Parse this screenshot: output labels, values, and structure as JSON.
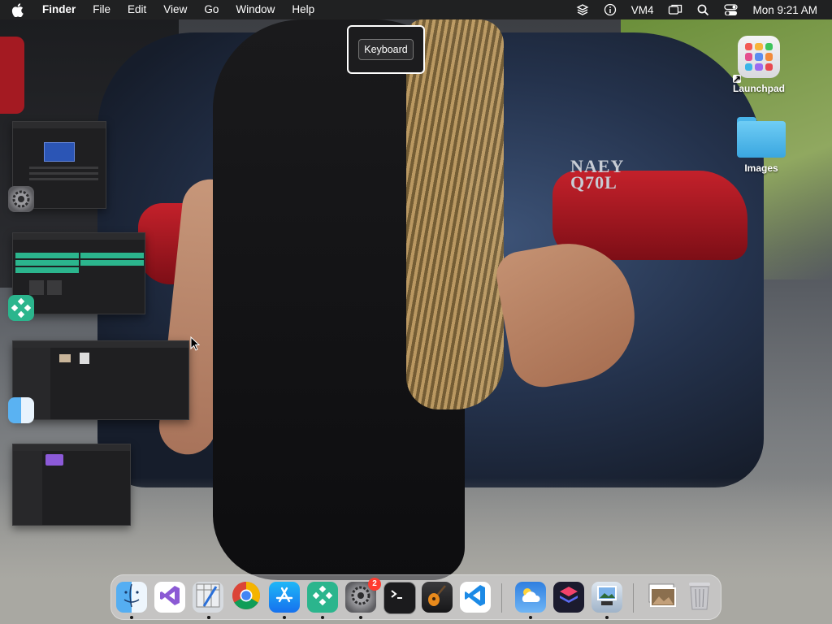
{
  "menubar": {
    "apple_icon": "apple-logo-icon",
    "app_name": "Finder",
    "menus": [
      "File",
      "Edit",
      "View",
      "Go",
      "Window",
      "Help"
    ],
    "status_label": "VM4",
    "clock": "Mon 9:21 AM"
  },
  "hud": {
    "label": "Keyboard"
  },
  "desktop": {
    "icons": [
      {
        "label": "Launchpad",
        "icon": "launchpad-icon"
      },
      {
        "label": "Images",
        "icon": "folder-icon"
      }
    ]
  },
  "wallpaper": {
    "car_badge": "NAEY\nQ70L"
  },
  "stage_manager": {
    "apps": [
      "System Settings",
      "App with green cells",
      "Finder",
      "Notes-like app"
    ]
  },
  "dock": {
    "items": [
      {
        "name": "Finder",
        "icon": "finder-icon",
        "running": true
      },
      {
        "name": "Visual Studio",
        "icon": "visual-studio-icon",
        "running": true
      },
      {
        "name": "Script Editor",
        "icon": "script-editor-icon",
        "running": true
      },
      {
        "name": "Google Chrome",
        "icon": "chrome-icon",
        "running": false
      },
      {
        "name": "App Store",
        "icon": "app-store-icon",
        "running": true
      },
      {
        "name": "Green diamond app",
        "icon": "green-diamond-icon",
        "running": true
      },
      {
        "name": "System Settings",
        "icon": "settings-icon",
        "running": true,
        "badge": "2"
      },
      {
        "name": "Terminal",
        "icon": "terminal-icon",
        "running": false
      },
      {
        "name": "GarageBand",
        "icon": "guitar-icon",
        "running": false
      },
      {
        "name": "Visual Studio Code",
        "icon": "vscode-icon",
        "running": false
      },
      {
        "name": "Weather",
        "icon": "weather-icon",
        "running": true
      },
      {
        "name": "Shortcuts",
        "icon": "shortcuts-icon",
        "running": false
      },
      {
        "name": "Preview",
        "icon": "preview-icon",
        "running": true
      },
      {
        "name": "Photos stack",
        "icon": "photos-stack-icon",
        "running": false
      },
      {
        "name": "Trash",
        "icon": "trash-icon",
        "running": false
      }
    ],
    "badge_value": "2"
  },
  "colors": {
    "menubar_bg": "#1e1e20",
    "accent_green": "#2bb58d",
    "badge_red": "#ff3b30"
  }
}
